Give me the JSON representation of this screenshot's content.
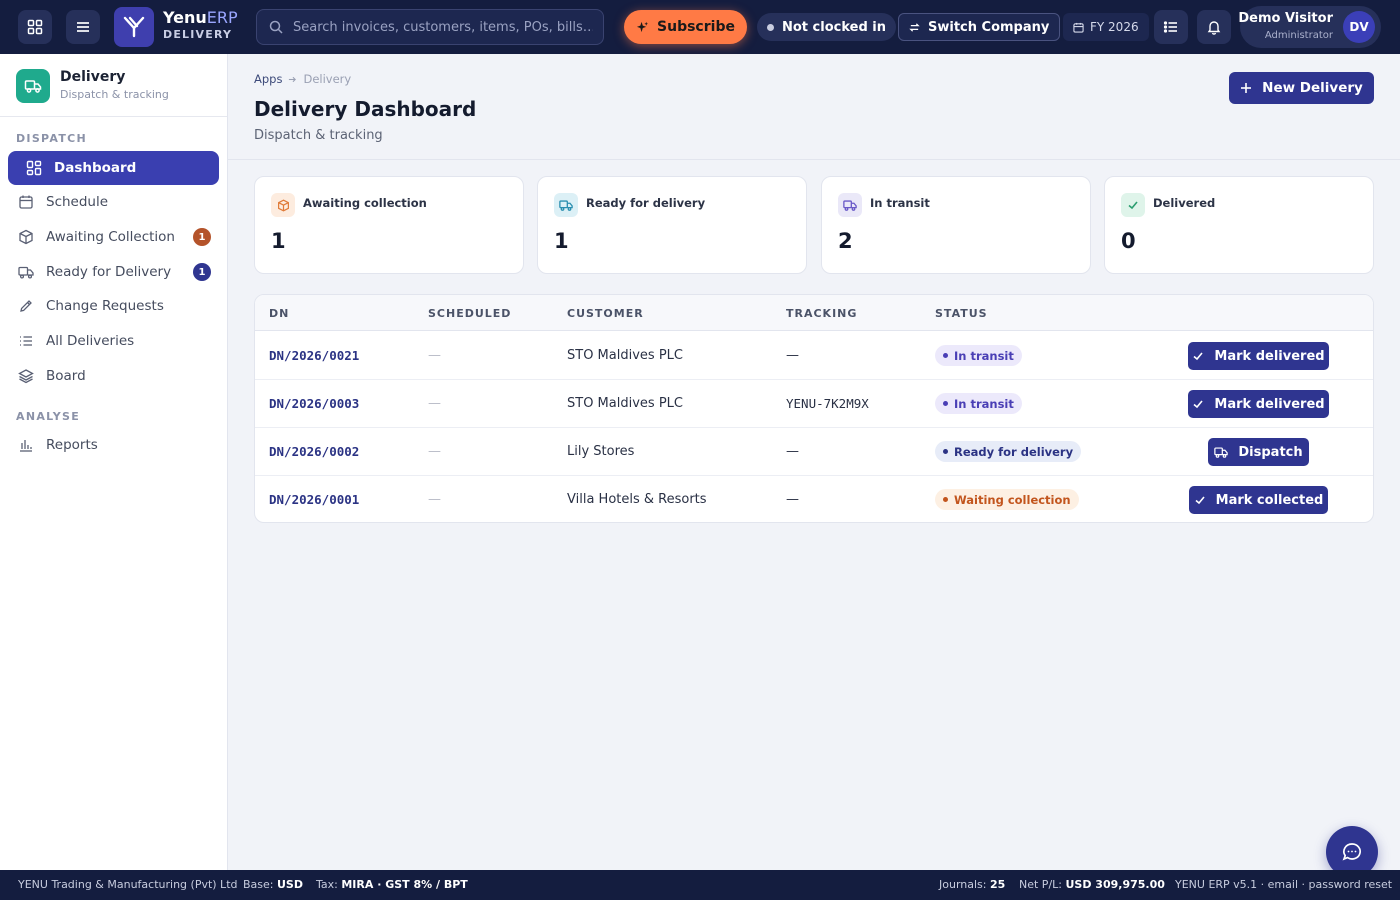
{
  "header": {
    "brand_name": "Yenu",
    "brand_suffix": "ERP",
    "brand_sub": "DELIVERY",
    "search_placeholder": "Search invoices, customers, items, POs, bills…",
    "subscribe_label": "Subscribe",
    "clock_status": "Not clocked in",
    "switch_company_label": "Switch Company",
    "fiscal_year": "FY 2026",
    "user_name": "Demo Visitor",
    "user_role": "Administrator",
    "user_initials": "DV"
  },
  "sidebar": {
    "app_title": "Delivery",
    "app_subtitle": "Dispatch & tracking",
    "section_dispatch": "DISPATCH",
    "section_analyse": "ANALYSE",
    "items": [
      {
        "label": "Dashboard",
        "icon": "dashboard-icon",
        "active": true
      },
      {
        "label": "Schedule",
        "icon": "calendar-icon"
      },
      {
        "label": "Awaiting Collection",
        "icon": "box-icon",
        "badge": "1",
        "badge_color": "#b4532a"
      },
      {
        "label": "Ready for Delivery",
        "icon": "truck-icon",
        "badge": "1",
        "badge_color": "#2f3590"
      },
      {
        "label": "Change Requests",
        "icon": "pencil-icon"
      },
      {
        "label": "All Deliveries",
        "icon": "list-icon"
      },
      {
        "label": "Board",
        "icon": "layers-icon"
      }
    ],
    "analyse_items": [
      {
        "label": "Reports",
        "icon": "bar-chart-icon"
      }
    ]
  },
  "main": {
    "breadcrumb": [
      "Apps",
      "Delivery"
    ],
    "title": "Delivery Dashboard",
    "subtitle": "Dispatch & tracking",
    "new_button": "New Delivery",
    "cards": [
      {
        "label": "Awaiting collection",
        "value": "1",
        "icon": "box-icon",
        "color": "#e07b39",
        "bg": "#fdecdf"
      },
      {
        "label": "Ready for delivery",
        "value": "1",
        "icon": "truck-icon",
        "color": "#2b8fb0",
        "bg": "#dcf0f6"
      },
      {
        "label": "In transit",
        "value": "2",
        "icon": "truck-icon",
        "color": "#6a5ac8",
        "bg": "#eae8f8"
      },
      {
        "label": "Delivered",
        "value": "0",
        "icon": "check-icon",
        "color": "#2a9d6f",
        "bg": "#dff4ea"
      }
    ],
    "table": {
      "columns": [
        "DN",
        "SCHEDULED",
        "CUSTOMER",
        "TRACKING",
        "STATUS"
      ],
      "rows": [
        {
          "dn": "DN/2026/0021",
          "scheduled": "—",
          "customer": "STO Maldives PLC",
          "tracking": "—",
          "status": "In transit",
          "action": "Mark delivered"
        },
        {
          "dn": "DN/2026/0003",
          "scheduled": "—",
          "customer": "STO Maldives PLC",
          "tracking": "YENU-7K2M9X",
          "status": "In transit",
          "action": "Mark delivered"
        },
        {
          "dn": "DN/2026/0002",
          "scheduled": "—",
          "customer": "Lily Stores",
          "tracking": "—",
          "status": "Ready for delivery",
          "action": "Dispatch"
        },
        {
          "dn": "DN/2026/0001",
          "scheduled": "—",
          "customer": "Villa Hotels & Resorts",
          "tracking": "—",
          "status": "Waiting collection",
          "action": "Mark collected"
        }
      ]
    },
    "status_colors": {
      "in_transit": {
        "text": "#4a3fb5",
        "bg": "#ece9fb"
      },
      "ready": {
        "text": "#2b3384",
        "bg": "#e7ecf8"
      },
      "waiting": {
        "text": "#c2551d",
        "bg": "#fdf0e3"
      }
    }
  },
  "footer": {
    "company": "YENU Trading & Manufacturing (Pvt) Ltd",
    "base_label": "Base:",
    "base_value": "USD",
    "tax_label": "Tax:",
    "tax_value": "MIRA · GST 8% / BPT",
    "journals_label": "Journals:",
    "journals_value": "25",
    "netpl_label": "Net P/L:",
    "netpl_value": "USD 309,975.00",
    "version": "YENU ERP v5.1 · email · password reset"
  }
}
